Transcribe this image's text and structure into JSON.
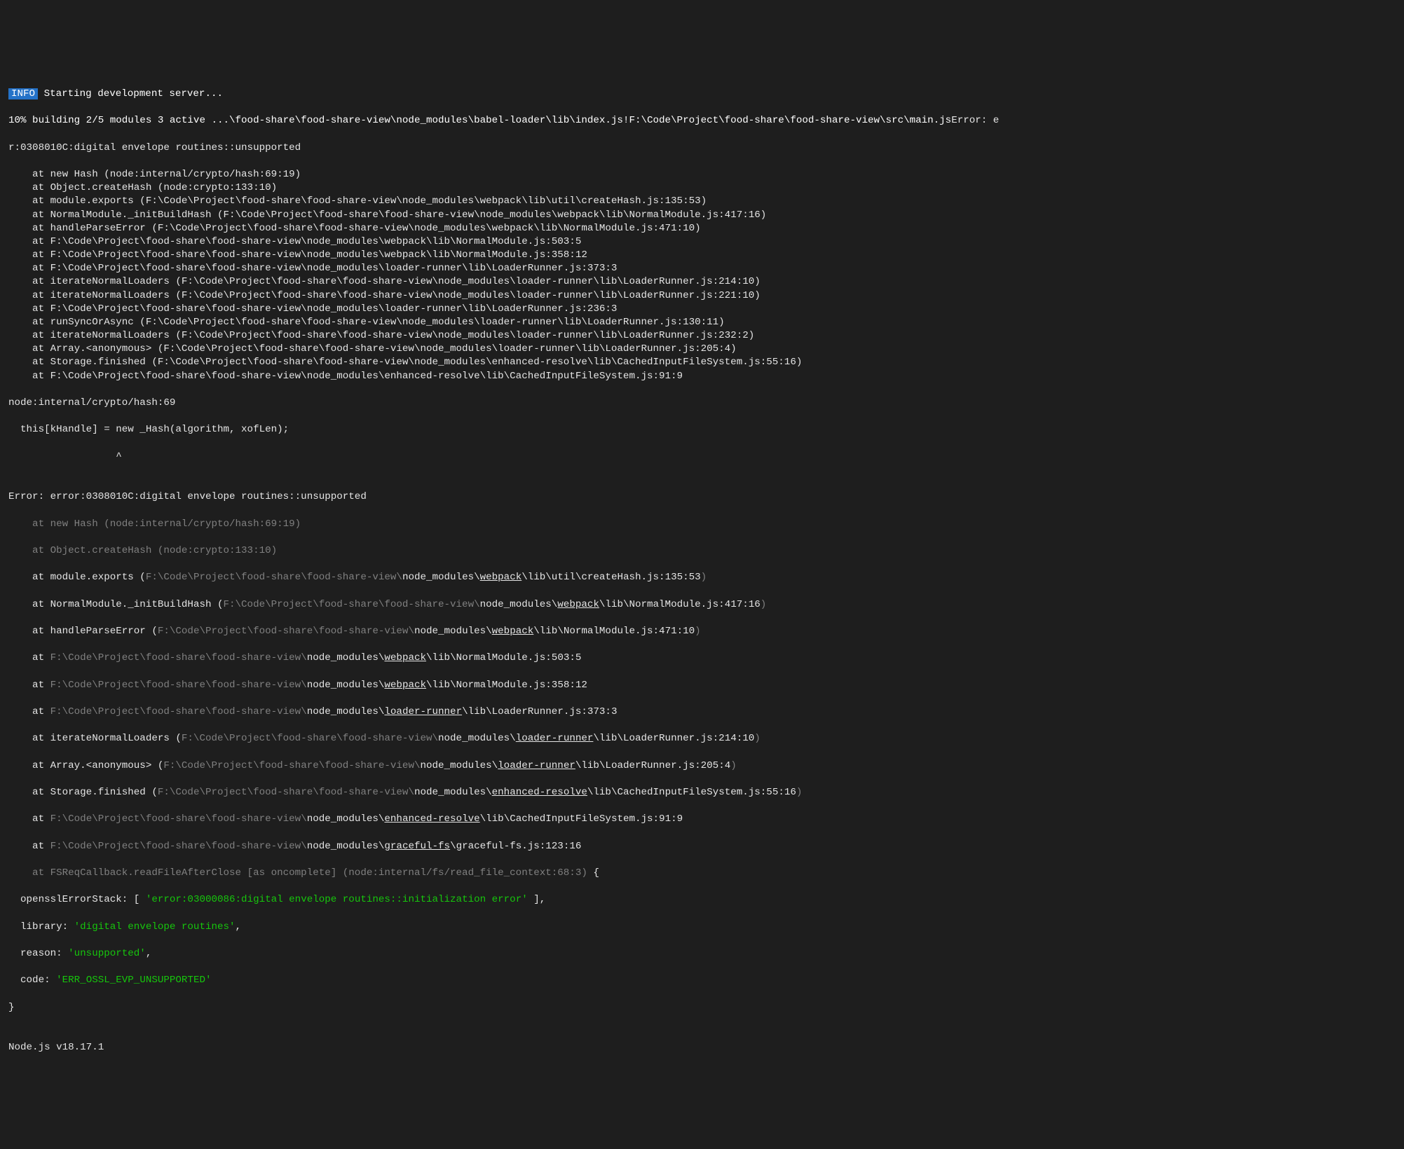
{
  "badge": "INFO",
  "startMsg": " Starting development server...",
  "progress": "10% building 2/5 modules 3 active ...\\food-share\\food-share-view\\node_modules\\babel-loader\\lib\\index.js!F:\\Code\\Project\\food-share\\food-share-view\\src\\main.js",
  "errHead": "Error: e",
  "errLine2": "r:0308010C:digital envelope routines::unsupported",
  "stack1": [
    "    at new Hash (node:internal/crypto/hash:69:19)",
    "    at Object.createHash (node:crypto:133:10)",
    "    at module.exports (F:\\Code\\Project\\food-share\\food-share-view\\node_modules\\webpack\\lib\\util\\createHash.js:135:53)",
    "    at NormalModule._initBuildHash (F:\\Code\\Project\\food-share\\food-share-view\\node_modules\\webpack\\lib\\NormalModule.js:417:16)",
    "    at handleParseError (F:\\Code\\Project\\food-share\\food-share-view\\node_modules\\webpack\\lib\\NormalModule.js:471:10)",
    "    at F:\\Code\\Project\\food-share\\food-share-view\\node_modules\\webpack\\lib\\NormalModule.js:503:5",
    "    at F:\\Code\\Project\\food-share\\food-share-view\\node_modules\\webpack\\lib\\NormalModule.js:358:12",
    "    at F:\\Code\\Project\\food-share\\food-share-view\\node_modules\\loader-runner\\lib\\LoaderRunner.js:373:3",
    "    at iterateNormalLoaders (F:\\Code\\Project\\food-share\\food-share-view\\node_modules\\loader-runner\\lib\\LoaderRunner.js:214:10)",
    "    at iterateNormalLoaders (F:\\Code\\Project\\food-share\\food-share-view\\node_modules\\loader-runner\\lib\\LoaderRunner.js:221:10)",
    "    at F:\\Code\\Project\\food-share\\food-share-view\\node_modules\\loader-runner\\lib\\LoaderRunner.js:236:3",
    "    at runSyncOrAsync (F:\\Code\\Project\\food-share\\food-share-view\\node_modules\\loader-runner\\lib\\LoaderRunner.js:130:11)",
    "    at iterateNormalLoaders (F:\\Code\\Project\\food-share\\food-share-view\\node_modules\\loader-runner\\lib\\LoaderRunner.js:232:2)",
    "    at Array.<anonymous> (F:\\Code\\Project\\food-share\\food-share-view\\node_modules\\loader-runner\\lib\\LoaderRunner.js:205:4)",
    "    at Storage.finished (F:\\Code\\Project\\food-share\\food-share-view\\node_modules\\enhanced-resolve\\lib\\CachedInputFileSystem.js:55:16)",
    "    at F:\\Code\\Project\\food-share\\food-share-view\\node_modules\\enhanced-resolve\\lib\\CachedInputFileSystem.js:91:9"
  ],
  "ctx1": "node:internal/crypto/hash:69",
  "ctx2": "  this[kHandle] = new _Hash(algorithm, xofLen);",
  "ctx3": "                  ^",
  "blank": "",
  "errTitle": "Error: error:0308010C:digital envelope routines::unsupported",
  "s2l1_dim": "    at new Hash (node:internal/crypto/hash:69:19)",
  "s2l2_dim": "    at Object.createHash (node:crypto:133:10)",
  "s2l3_a": "    at module.exports (",
  "s2l3_b": "F:\\Code\\Project\\food-share\\food-share-view\\",
  "s2l3_c": "node_modules\\",
  "s2l3_d": "webpack",
  "s2l3_e": "\\lib\\util\\createHash.js:135:53",
  "s2l3_f": ")",
  "s2l4_a": "    at NormalModule._initBuildHash (",
  "s2l4_b": "F:\\Code\\Project\\food-share\\food-share-view\\",
  "s2l4_c": "node_modules\\",
  "s2l4_d": "webpack",
  "s2l4_e": "\\lib\\NormalModule.js:417:16",
  "s2l4_f": ")",
  "s2l5_a": "    at handleParseError (",
  "s2l5_b": "F:\\Code\\Project\\food-share\\food-share-view\\",
  "s2l5_c": "node_modules\\",
  "s2l5_d": "webpack",
  "s2l5_e": "\\lib\\NormalModule.js:471:10",
  "s2l5_f": ")",
  "s2l6_a": "    at ",
  "s2l6_b": "F:\\Code\\Project\\food-share\\food-share-view\\",
  "s2l6_c": "node_modules\\",
  "s2l6_d": "webpack",
  "s2l6_e": "\\lib\\NormalModule.js:503:5",
  "s2l7_a": "    at ",
  "s2l7_b": "F:\\Code\\Project\\food-share\\food-share-view\\",
  "s2l7_c": "node_modules\\",
  "s2l7_d": "webpack",
  "s2l7_e": "\\lib\\NormalModule.js:358:12",
  "s2l8_a": "    at ",
  "s2l8_b": "F:\\Code\\Project\\food-share\\food-share-view\\",
  "s2l8_c": "node_modules\\",
  "s2l8_d": "loader-runner",
  "s2l8_e": "\\lib\\LoaderRunner.js:373:3",
  "s2l9_a": "    at iterateNormalLoaders (",
  "s2l9_b": "F:\\Code\\Project\\food-share\\food-share-view\\",
  "s2l9_c": "node_modules\\",
  "s2l9_d": "loader-runner",
  "s2l9_e": "\\lib\\LoaderRunner.js:214:10",
  "s2l9_f": ")",
  "s2l10_a": "    at Array.<anonymous> (",
  "s2l10_b": "F:\\Code\\Project\\food-share\\food-share-view\\",
  "s2l10_c": "node_modules\\",
  "s2l10_d": "loader-runner",
  "s2l10_e": "\\lib\\LoaderRunner.js:205:4",
  "s2l10_f": ")",
  "s2l11_a": "    at Storage.finished (",
  "s2l11_b": "F:\\Code\\Project\\food-share\\food-share-view\\",
  "s2l11_c": "node_modules\\",
  "s2l11_d": "enhanced-resolve",
  "s2l11_e": "\\lib\\CachedInputFileSystem.js:55:16",
  "s2l11_f": ")",
  "s2l12_a": "    at ",
  "s2l12_b": "F:\\Code\\Project\\food-share\\food-share-view\\",
  "s2l12_c": "node_modules\\",
  "s2l12_d": "enhanced-resolve",
  "s2l12_e": "\\lib\\CachedInputFileSystem.js:91:9",
  "s2l13_a": "    at ",
  "s2l13_b": "F:\\Code\\Project\\food-share\\food-share-view\\",
  "s2l13_c": "node_modules\\",
  "s2l13_d": "graceful-fs",
  "s2l13_e": "\\graceful-fs.js:123:16",
  "s2l14_dim": "    at FSReqCallback.readFileAfterClose [as oncomplete] (node:internal/fs/read_file_context:68:3)",
  "s2l14_brace": " {",
  "obj1_k": "  opensslErrorStack: [ ",
  "obj1_v": "'error:03000086:digital envelope routines::initialization error'",
  "obj1_e": " ],",
  "obj2_k": "  library: ",
  "obj2_v": "'digital envelope routines'",
  "obj2_e": ",",
  "obj3_k": "  reason: ",
  "obj3_v": "'unsupported'",
  "obj3_e": ",",
  "obj4_k": "  code: ",
  "obj4_v": "'ERR_OSSL_EVP_UNSUPPORTED'",
  "objClose": "}",
  "nodeVer": "Node.js v18.17.1"
}
